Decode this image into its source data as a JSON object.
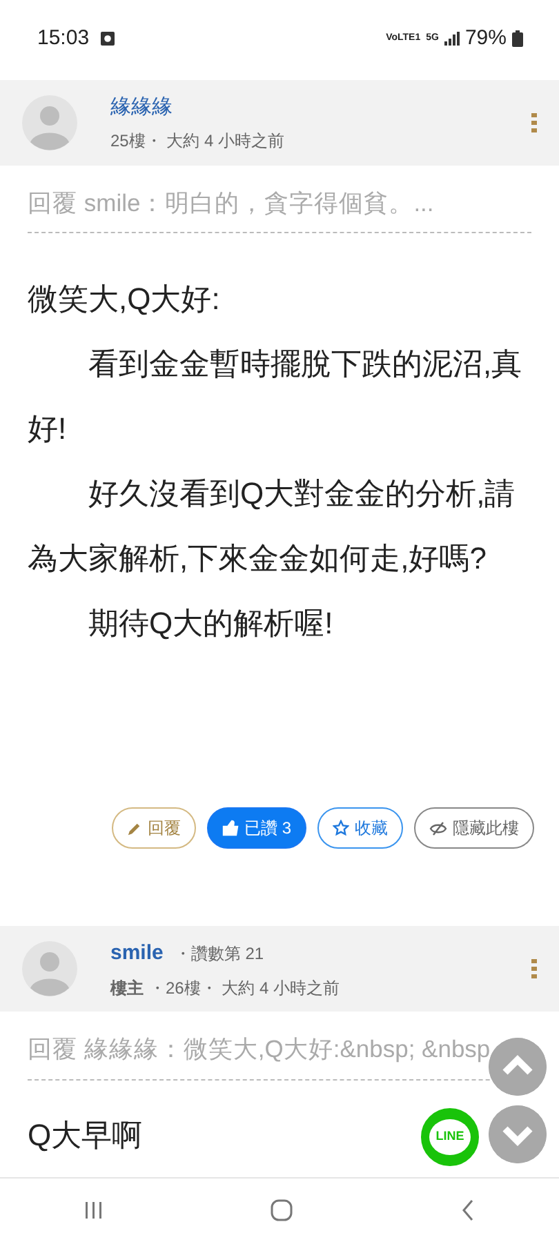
{
  "status_bar": {
    "time": "15:03",
    "indicators": [
      "VoLTE1",
      "5G"
    ],
    "battery": "79%"
  },
  "posts": [
    {
      "author": "緣緣緣",
      "meta": "25樓・ 大約 4 小時之前",
      "reply_quote": "回覆 smile：明白的，貪字得個貧。...",
      "body": [
        {
          "text": "微笑大,Q大好:",
          "indent": false
        },
        {
          "text": "看到金金暫時擺脫下跌的泥沼,真好!",
          "indent": true
        },
        {
          "text": "好久沒看到Q大對金金的分析,請為大家解析,下來金金如何走,好嗎?",
          "indent": true
        },
        {
          "text": "期待Q大的解析喔!",
          "indent": true
        }
      ],
      "actions": [
        {
          "kind": "reply",
          "label": "回覆",
          "selected": false
        },
        {
          "kind": "like",
          "label": "已讚 3",
          "selected": true
        },
        {
          "kind": "favorite",
          "label": "收藏",
          "selected": false
        },
        {
          "kind": "hide",
          "label": "隱藏此樓",
          "selected": false
        }
      ]
    },
    {
      "author": "smile",
      "rank": "・讚數第 21",
      "role": "樓主",
      "meta": "・26樓・ 大約 4 小時之前",
      "reply_quote": "回覆 緣緣緣：微笑大,Q大好:&nbsp; &nbsp",
      "body": [
        {
          "text": "Q大早啊",
          "indent": false
        }
      ]
    }
  ],
  "floating": {
    "share_label": "LINE"
  }
}
